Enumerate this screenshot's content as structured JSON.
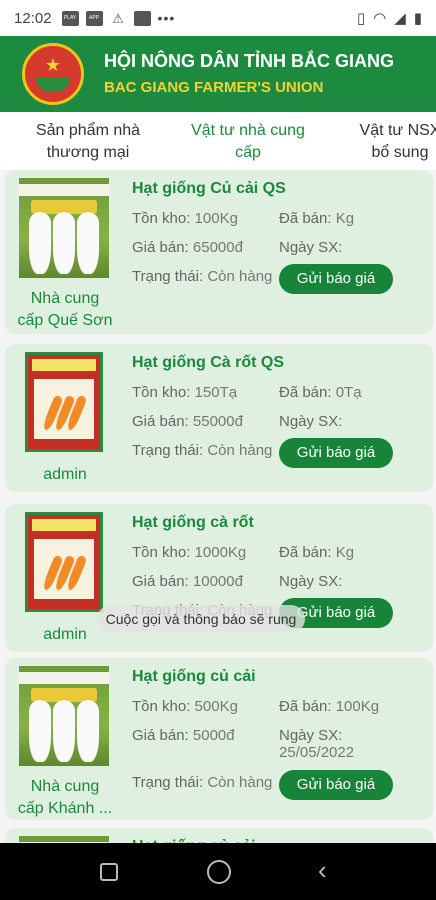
{
  "status_bar": {
    "time": "12:02",
    "icons": [
      "play-store-icon",
      "app-icon",
      "alert-icon",
      "image-icon"
    ],
    "dots": "•••"
  },
  "header": {
    "title": "HỘI NÔNG DÂN TỈNH BẮC GIANG",
    "subtitle": "BAC GIANG FARMER'S UNION"
  },
  "tabs": [
    {
      "label": "Sản phẩm nhà\nthương mại",
      "active": false
    },
    {
      "label": "Vật tư nhà cung\ncấp",
      "active": true
    },
    {
      "label": "Vật tư NSX\nbổ sung",
      "active": false
    }
  ],
  "labels": {
    "stock": "Tồn kho:",
    "sold": "Đã bán:",
    "price": "Giá bán:",
    "mfg": "Ngày SX:",
    "status": "Trạng thái:",
    "button": "Gửi báo giá"
  },
  "products": [
    {
      "name": "Hạt giống Củ cải QS",
      "stock": "100Kg",
      "sold": "Kg",
      "price": "65000đ",
      "mfg": "",
      "status": "Còn hàng",
      "supplier": "Nhà cung\ncấp Quế Sơn",
      "image": "radish"
    },
    {
      "name": "Hạt giống Cà rốt QS",
      "stock": "150Tạ",
      "sold": "0Tạ",
      "price": "55000đ",
      "mfg": "",
      "status": "Còn hàng",
      "supplier": "admin",
      "image": "carrot"
    },
    {
      "name": "Hạt giống cà rốt",
      "stock": "1000Kg",
      "sold": "Kg",
      "price": "10000đ",
      "mfg": "",
      "status": "Còn hàng",
      "supplier": "admin",
      "image": "carrot"
    },
    {
      "name": "Hạt giống củ cải",
      "stock": "500Kg",
      "sold": "100Kg",
      "price": "5000đ",
      "mfg": "25/05/2022",
      "status": "Còn hàng",
      "supplier": "Nhà cung\ncấp Khánh ...",
      "image": "radish"
    },
    {
      "name": "Hạt giống củ cải",
      "stock": "",
      "sold": "",
      "price": "",
      "mfg": "",
      "status": "",
      "supplier": "",
      "image": "radish"
    }
  ],
  "toast": "Cuộc gọi và thông báo sẽ rung",
  "colors": {
    "primary": "#1d8b3f",
    "accent": "#f3d232",
    "card": "#dff0e1"
  }
}
